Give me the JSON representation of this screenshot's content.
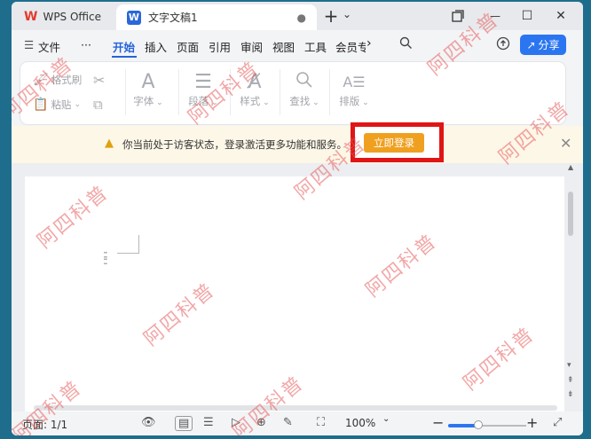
{
  "titlebar": {
    "app_name": "WPS Office",
    "doc_tab": "文字文稿1",
    "doc_tab_dot": "●",
    "new_tab": "+",
    "tab_dropdown": "⌄",
    "minimize": "—",
    "maximize": "☐",
    "close": "✕"
  },
  "menubar": {
    "file_label": "文件",
    "more": "···",
    "items": [
      "开始",
      "插入",
      "页面",
      "引用",
      "审阅",
      "视图",
      "工具",
      "会员专"
    ],
    "share_label": "分享"
  },
  "ribbon": {
    "format_painter": "格式刷",
    "paste": "粘贴",
    "font": "字体",
    "paragraph": "段落",
    "styles": "样式",
    "find": "查找",
    "layout": "排版"
  },
  "notice": {
    "text": "你当前处于访客状态，登录激活更多功能和服务。",
    "login_button": "立即登录"
  },
  "statusbar": {
    "page": "页面: 1/1",
    "zoom": "100%"
  },
  "watermark": "阿四科普",
  "colors": {
    "accent": "#2b76f0",
    "login": "#f0a020",
    "highlight_box": "#e01515",
    "wps_red": "#e23b2e"
  }
}
